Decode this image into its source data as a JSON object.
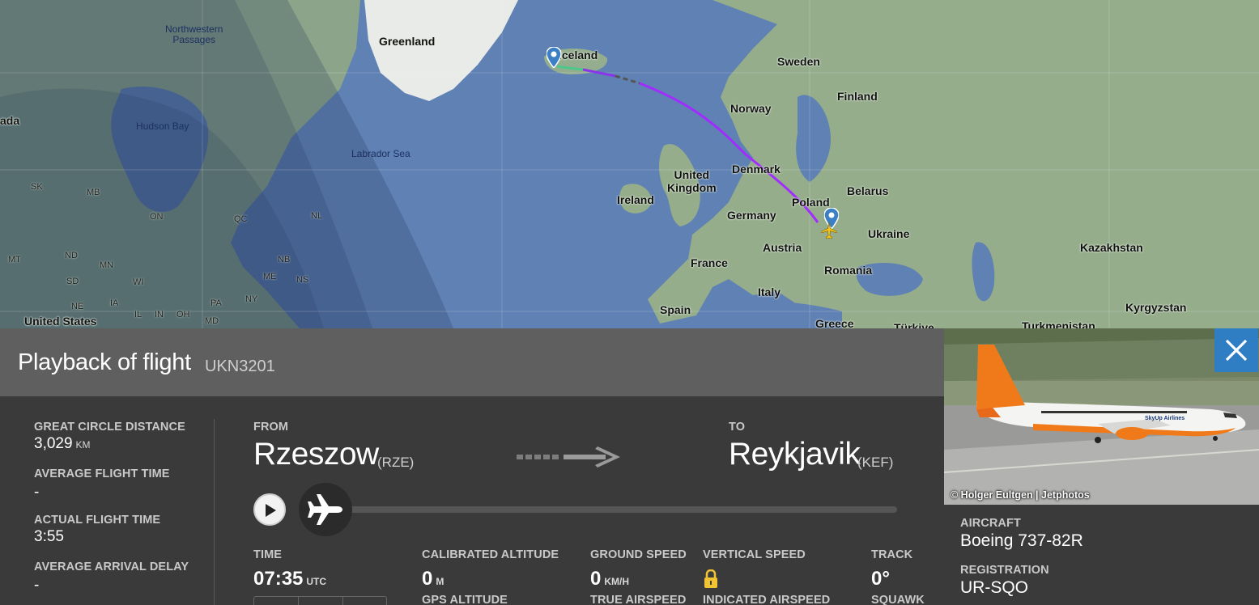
{
  "map": {
    "labels": {
      "northwestern_passages": "Northwestern\nPassages",
      "greenland": "Greenland",
      "iceland": "Iceland",
      "sweden": "Sweden",
      "finland": "Finland",
      "norway": "Norway",
      "hudson_bay": "Hudson Bay",
      "labrador_sea": "Labrador Sea",
      "canada_partial": "ada",
      "denmark": "Denmark",
      "united_kingdom": "United\nKingdom",
      "ireland": "Ireland",
      "belarus": "Belarus",
      "poland": "Poland",
      "germany": "Germany",
      "ukraine": "Ukraine",
      "kazakhstan": "Kazakhstan",
      "austria": "Austria",
      "france": "France",
      "romania": "Romania",
      "italy": "Italy",
      "spain": "Spain",
      "kyrgyzstan": "Kyrgyzstan",
      "united_states": "United States",
      "greece": "Greece",
      "turkiye": "Türkiye",
      "turkmenistan": "Turkmenistan",
      "sk": "SK",
      "mb": "MB",
      "on": "ON",
      "qc": "QC",
      "nl": "NL",
      "mt": "MT",
      "nd": "ND",
      "mn": "MN",
      "sd": "SD",
      "wi": "WI",
      "ia": "IA",
      "ne": "NE",
      "il": "IL",
      "in": "IN",
      "oh": "OH",
      "md": "MD",
      "pa": "PA",
      "ny": "NY",
      "nb": "NB",
      "ns": "NS",
      "me": "ME"
    },
    "route_color": "#a22cff"
  },
  "panel": {
    "title": "Playback of flight",
    "flight_number": "UKN3201",
    "great_circle_distance_label": "GREAT CIRCLE DISTANCE",
    "great_circle_distance_value": "3,029",
    "great_circle_distance_unit": "KM",
    "average_flight_time_label": "AVERAGE FLIGHT TIME",
    "average_flight_time_value": "-",
    "actual_flight_time_label": "ACTUAL FLIGHT TIME",
    "actual_flight_time_value": "3:55",
    "average_arrival_delay_label": "AVERAGE ARRIVAL DELAY",
    "average_arrival_delay_value": "-",
    "from_label": "FROM",
    "from_city": "Rzeszow",
    "from_code": "(RZE)",
    "to_label": "TO",
    "to_city": "Reykjavik",
    "to_code": "(KEF)",
    "playback_progress": 0,
    "time_label": "TIME",
    "time_value": "07:35",
    "time_unit": "UTC",
    "calibrated_altitude_label": "CALIBRATED ALTITUDE",
    "calibrated_altitude_value": "0",
    "calibrated_altitude_unit": "M",
    "gps_altitude_label": "GPS ALTITUDE",
    "ground_speed_label": "GROUND SPEED",
    "ground_speed_value": "0",
    "ground_speed_unit": "KM/H",
    "true_airspeed_label": "TRUE AIRSPEED",
    "vertical_speed_label": "VERTICAL SPEED",
    "indicated_airspeed_label": "INDICATED AIRSPEED",
    "track_label": "TRACK",
    "track_value": "0°",
    "squawk_label": "SQUAWK"
  },
  "aircraft": {
    "photo_credit": "© Holger Eultgen | Jetphotos",
    "livery_text": "SkyUp Airlines",
    "aircraft_label": "AIRCRAFT",
    "aircraft_value": "Boeing 737-82R",
    "registration_label": "REGISTRATION",
    "registration_value": "UR-SQO"
  },
  "colors": {
    "panel_bg": "#3a3a3a",
    "header_bg": "#5f5f5f",
    "close_button": "#2f7ec4",
    "lock_icon": "#f1c232"
  }
}
